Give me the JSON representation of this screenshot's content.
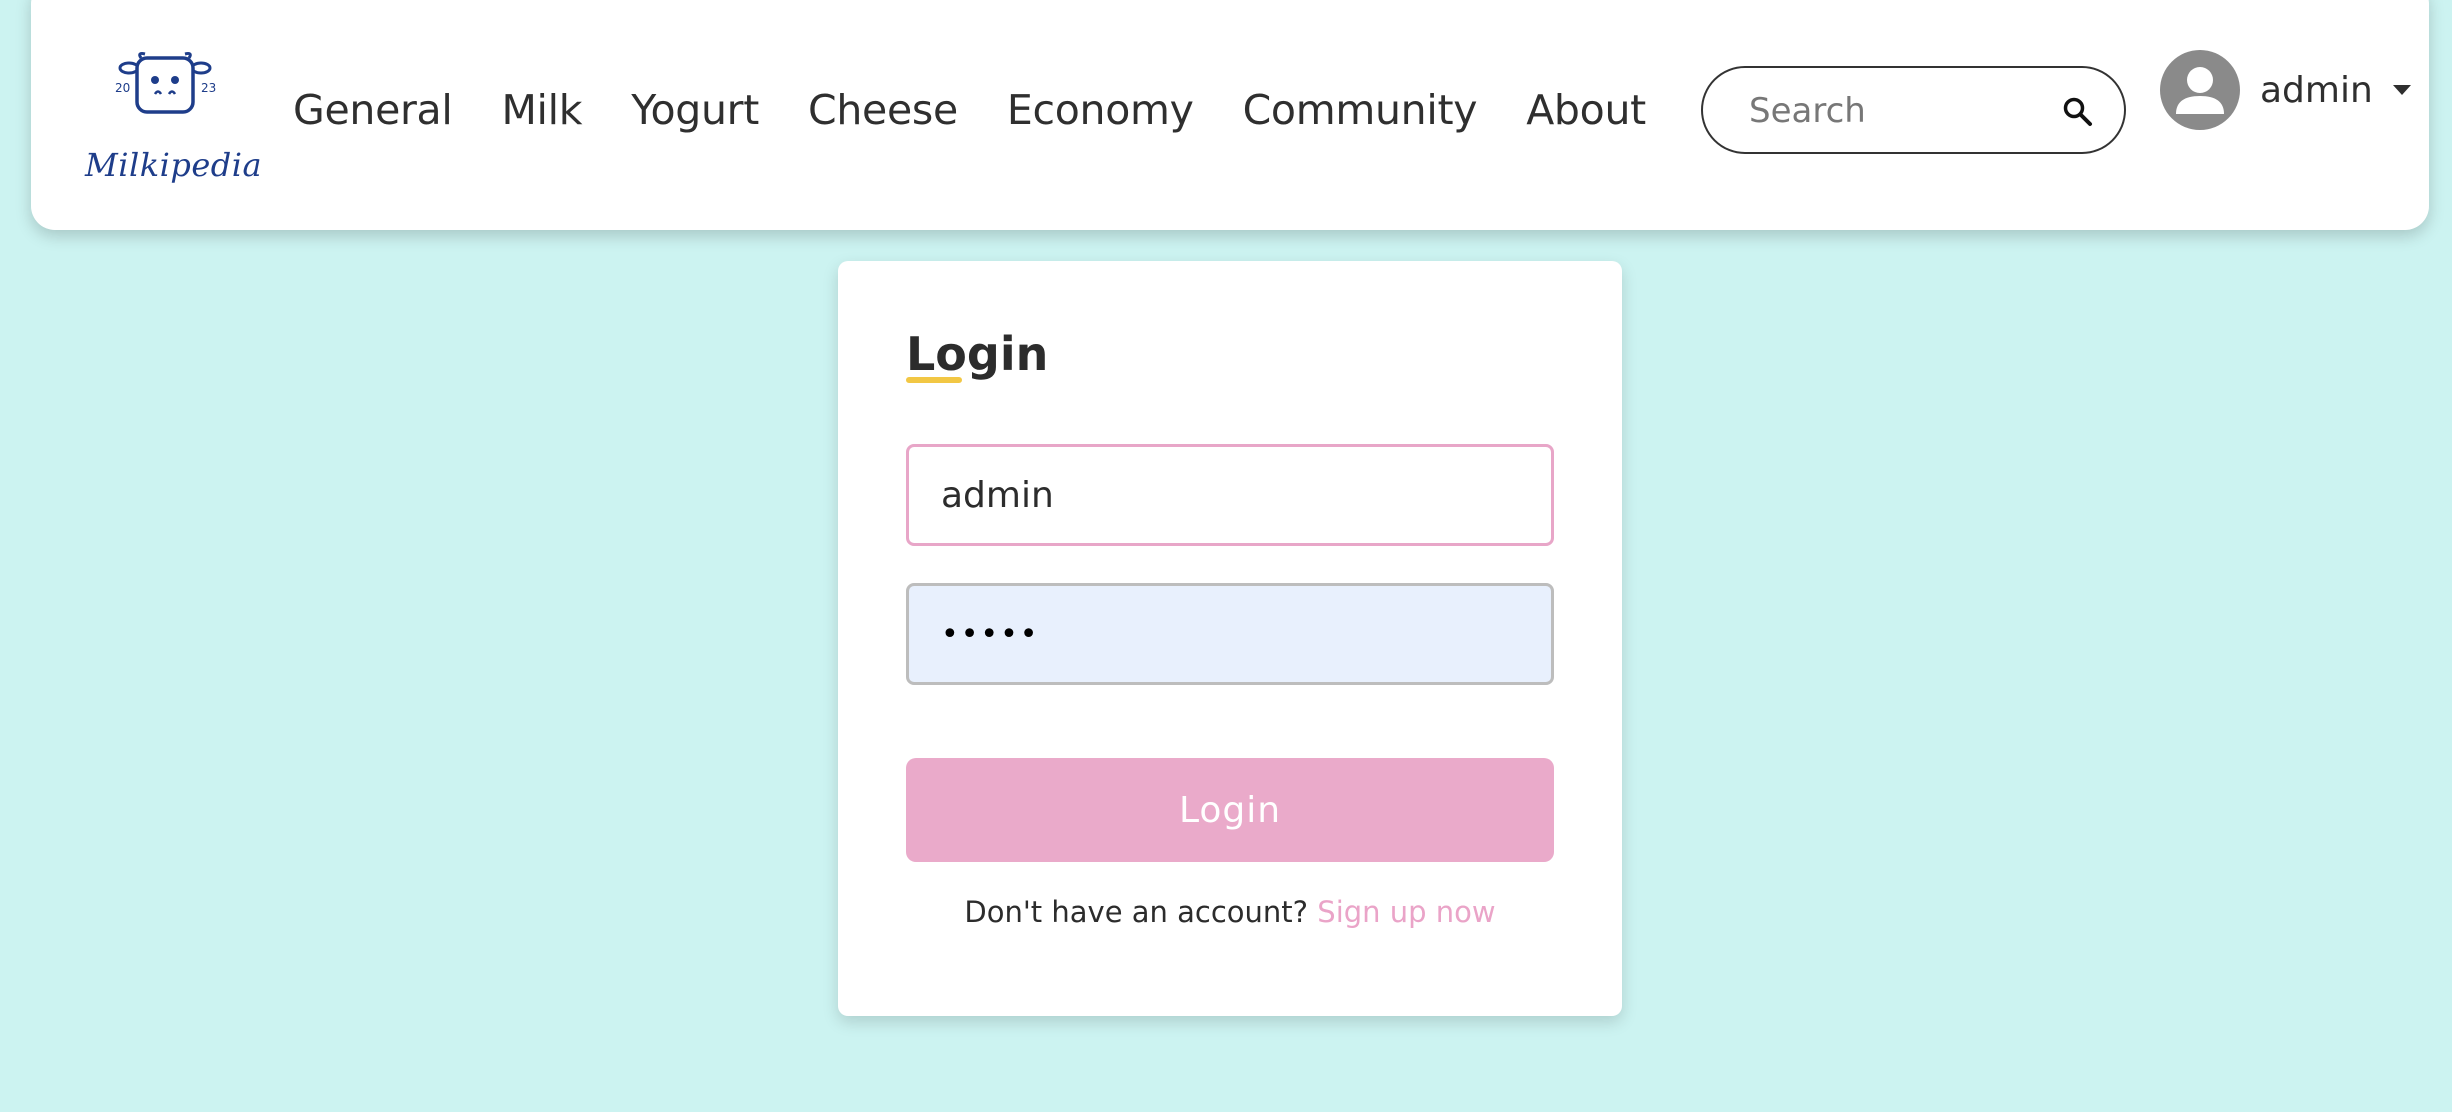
{
  "header": {
    "logo": {
      "text": "Milkipedia",
      "year_left": "20",
      "year_right": "23",
      "icon": "cow-face-icon"
    },
    "nav": [
      {
        "label": "General"
      },
      {
        "label": "Milk"
      },
      {
        "label": "Yogurt"
      },
      {
        "label": "Cheese"
      },
      {
        "label": "Economy"
      },
      {
        "label": "Community"
      },
      {
        "label": "About"
      }
    ],
    "search": {
      "placeholder": "Search",
      "value": "",
      "icon": "search-icon"
    },
    "user": {
      "name": "admin",
      "avatar_icon": "user-avatar-icon",
      "menu_icon": "caret-down-icon"
    }
  },
  "login": {
    "title": "Login",
    "username_value": "admin",
    "password_value": "•••••",
    "button_label": "Login",
    "signup_prompt": "Don't have an account?",
    "signup_link": "Sign up now"
  },
  "colors": {
    "background": "#ccf3f1",
    "accent_pink": "#eaaaca",
    "link_pink": "#eaa4c8",
    "title_underline": "#f2c744",
    "logo_blue": "#1e3d8a",
    "password_fill": "#e8f0fd"
  }
}
